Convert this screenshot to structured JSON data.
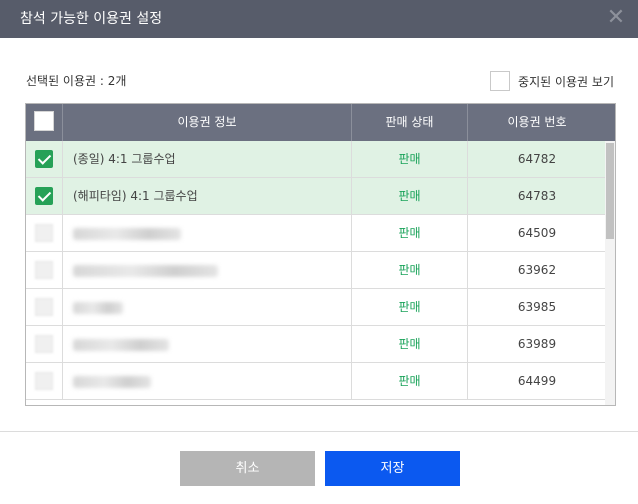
{
  "modal": {
    "title": "참석 가능한 이용권 설정",
    "selected_count": "선택된 이용권 : 2개",
    "show_stopped_label": "중지된 이용권 보기"
  },
  "table": {
    "headers": [
      "",
      "이용권 정보",
      "판매 상태",
      "이용권 번호"
    ],
    "rows": [
      {
        "checked": true,
        "info": "(종일) 4:1 그룹수업",
        "status": "판매",
        "number": "64782"
      },
      {
        "checked": true,
        "info": "(해피타임) 4:1 그룹수업",
        "status": "판매",
        "number": "64783"
      },
      {
        "checked": false,
        "info": "",
        "status": "판매",
        "number": "64509"
      },
      {
        "checked": false,
        "info": "",
        "status": "판매",
        "number": "63962"
      },
      {
        "checked": false,
        "info": "",
        "status": "판매",
        "number": "63985"
      },
      {
        "checked": false,
        "info": "",
        "status": "판매",
        "number": "63989"
      },
      {
        "checked": false,
        "info": "",
        "status": "판매",
        "number": "64499"
      }
    ]
  },
  "buttons": {
    "cancel": "취소",
    "save": "저장"
  },
  "colors": {
    "header_bg": "#575c6a",
    "table_header_bg": "#6b7080",
    "selected_row_bg": "#e0f2e4",
    "status_green": "#1aa35a",
    "checkbox_green": "#26a157",
    "save_button": "#0b59f0",
    "cancel_button": "#b5b5b5"
  },
  "icons": {
    "close": "close-icon",
    "check": "check-icon"
  }
}
